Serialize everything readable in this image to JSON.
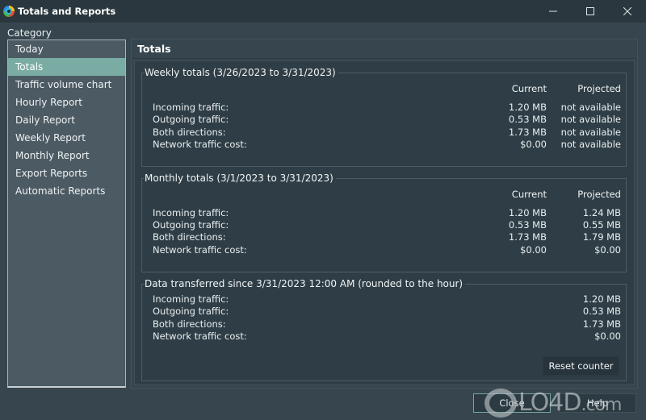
{
  "window": {
    "title": "Totals and Reports",
    "controls": {
      "minimize": "minimize",
      "maximize": "maximize",
      "close": "close"
    }
  },
  "sidebar": {
    "label": "Category",
    "items": [
      {
        "label": "Today",
        "selected": false
      },
      {
        "label": "Totals",
        "selected": true
      },
      {
        "label": "Traffic volume chart",
        "selected": false
      },
      {
        "label": "Hourly Report",
        "selected": false
      },
      {
        "label": "Daily Report",
        "selected": false
      },
      {
        "label": "Weekly Report",
        "selected": false
      },
      {
        "label": "Monthly Report",
        "selected": false
      },
      {
        "label": "Export Reports",
        "selected": false
      },
      {
        "label": "Automatic Reports",
        "selected": false
      }
    ]
  },
  "main": {
    "title": "Totals",
    "weekly": {
      "title": "Weekly totals (3/26/2023 to 3/31/2023)",
      "col_current": "Current",
      "col_projected": "Projected",
      "rows": [
        {
          "label": "Incoming traffic:",
          "current": "1.20 MB",
          "projected": "not available"
        },
        {
          "label": "Outgoing traffic:",
          "current": "0.53 MB",
          "projected": "not available"
        },
        {
          "label": "Both directions:",
          "current": "1.73 MB",
          "projected": "not available"
        },
        {
          "label": "Network traffic cost:",
          "current": "$0.00",
          "projected": "not available"
        }
      ]
    },
    "monthly": {
      "title": "Monthly totals (3/1/2023 to 3/31/2023)",
      "col_current": "Current",
      "col_projected": "Projected",
      "rows": [
        {
          "label": "Incoming traffic:",
          "current": "1.20 MB",
          "projected": "1.24 MB"
        },
        {
          "label": "Outgoing traffic:",
          "current": "0.53 MB",
          "projected": "0.55 MB"
        },
        {
          "label": "Both directions:",
          "current": "1.73 MB",
          "projected": "1.79 MB"
        },
        {
          "label": "Network traffic cost:",
          "current": "$0.00",
          "projected": "$0.00"
        }
      ]
    },
    "since": {
      "title": "Data transferred since 3/31/2023 12:00 AM (rounded to the hour)",
      "rows": [
        {
          "label": "Incoming traffic:",
          "value": "1.20 MB"
        },
        {
          "label": "Outgoing traffic:",
          "value": "0.53 MB"
        },
        {
          "label": "Both directions:",
          "value": "1.73 MB"
        },
        {
          "label": "Network traffic cost:",
          "value": "$0.00"
        }
      ],
      "reset_label": "Reset counter"
    }
  },
  "footer": {
    "close_label": "Close",
    "help_label": "Help"
  },
  "watermark": {
    "text": "LO4D",
    "suffix": ".com"
  },
  "colors": {
    "selected_item": "#7aaca4",
    "background": "#37464e",
    "panel": "#2f3e46",
    "sidebar": "#4c5a63"
  }
}
